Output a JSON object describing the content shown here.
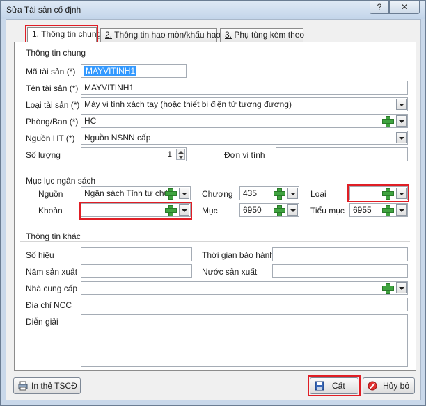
{
  "window": {
    "title": "Sửa Tài sản cố định",
    "help_label": "?",
    "close_label": "✕"
  },
  "tabs": [
    {
      "number": "1.",
      "label": "Thông tin chung"
    },
    {
      "number": "2.",
      "label": "Thông tin hao mòn/khấu hao"
    },
    {
      "number": "3.",
      "label": "Phụ tùng kèm theo"
    }
  ],
  "general": {
    "section_title": "Thông tin chung",
    "ma_tai_san": {
      "label": "Mã tài sản (*)",
      "value": "MAYVITINH1"
    },
    "ten_tai_san": {
      "label": "Tên tài sản (*)",
      "value": "MAYVITINH1"
    },
    "loai_tai_san": {
      "label": "Loại tài sản (*)",
      "value": "Máy vi tính xách tay (hoặc thiết bị điện tử tương đương)"
    },
    "phong_ban": {
      "label": "Phòng/Ban (*)",
      "value": "HC"
    },
    "nguon_ht": {
      "label": "Nguồn HT (*)",
      "value": "Nguồn NSNN cấp"
    },
    "so_luong": {
      "label": "Số lượng",
      "value": "1"
    },
    "don_vi_tinh": {
      "label": "Đơn vị tính",
      "value": ""
    }
  },
  "budget": {
    "section_title": "Mục lục ngân sách",
    "nguon": {
      "label": "Nguồn",
      "value": "Ngân sách Tỉnh tự chủ"
    },
    "chuong": {
      "label": "Chương",
      "value": "435"
    },
    "loai": {
      "label": "Loại",
      "value": ""
    },
    "khoan": {
      "label": "Khoản",
      "value": ""
    },
    "muc": {
      "label": "Mục",
      "value": "6950"
    },
    "tieu_muc": {
      "label": "Tiểu mục",
      "value": "6955"
    }
  },
  "other": {
    "section_title": "Thông tin khác",
    "so_hieu": {
      "label": "Số hiệu",
      "value": ""
    },
    "thoi_gian_bao_hanh": {
      "label": "Thời gian bảo hành",
      "value": ""
    },
    "nam_san_xuat": {
      "label": "Năm sản xuất",
      "value": ""
    },
    "nuoc_san_xuat": {
      "label": "Nước sản xuất",
      "value": ""
    },
    "nha_cung_cap": {
      "label": "Nhà cung cấp",
      "value": ""
    },
    "dia_chi_ncc": {
      "label": "Địa chỉ NCC",
      "value": ""
    },
    "dien_giai": {
      "label": "Diễn giải",
      "value": ""
    }
  },
  "footer": {
    "print_label": "In thẻ TSCĐ",
    "save_label": "Cất",
    "cancel_label": "Hủy bỏ"
  },
  "colors": {
    "highlight": "#e01e25",
    "selection": "#3399ff",
    "plus_icon": "#3fa33f"
  }
}
